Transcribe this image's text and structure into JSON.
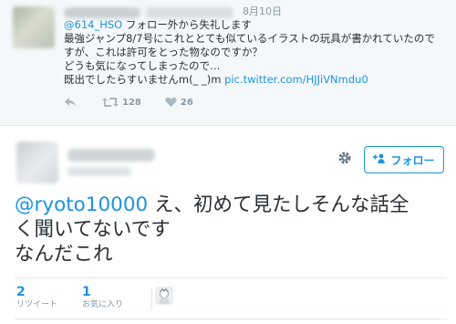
{
  "quoted_tweet": {
    "date": "8月10日",
    "lines": [
      {
        "mention": "@614_HSO",
        "text": " フォロー外から失礼します"
      },
      {
        "text": "最強ジャンプ8/7号にこれととても似ているイラストの玩具が書かれていたので"
      },
      {
        "text": "すが、これは許可をとった物なのですか？"
      },
      {
        "text": "どうも気になってしまったので…"
      },
      {
        "text": "既出でしたらすいませんm(_ _)m ",
        "link": "pic.twitter.com/HJJiVNmdu0"
      }
    ],
    "actions": {
      "reply_icon": "reply-icon",
      "retweet_icon": "retweet-icon",
      "retweet_count": "128",
      "like_icon": "heart-icon",
      "like_count": "26"
    }
  },
  "main_tweet": {
    "follow_label": "フォロー",
    "text_mention": "@ryoto10000",
    "text_line1": " え、初めて見たしそんな話全",
    "text_line2": "く聞いてないです",
    "text_line3": "なんだこれ",
    "retweets": {
      "count": "2",
      "label": "リツイート"
    },
    "likes": {
      "count": "1",
      "label": "お気に入り"
    }
  },
  "colors": {
    "accent": "#1b95e0",
    "text": "#292f33",
    "muted": "#8899a6",
    "bg_quoted": "#f5f8fa"
  }
}
